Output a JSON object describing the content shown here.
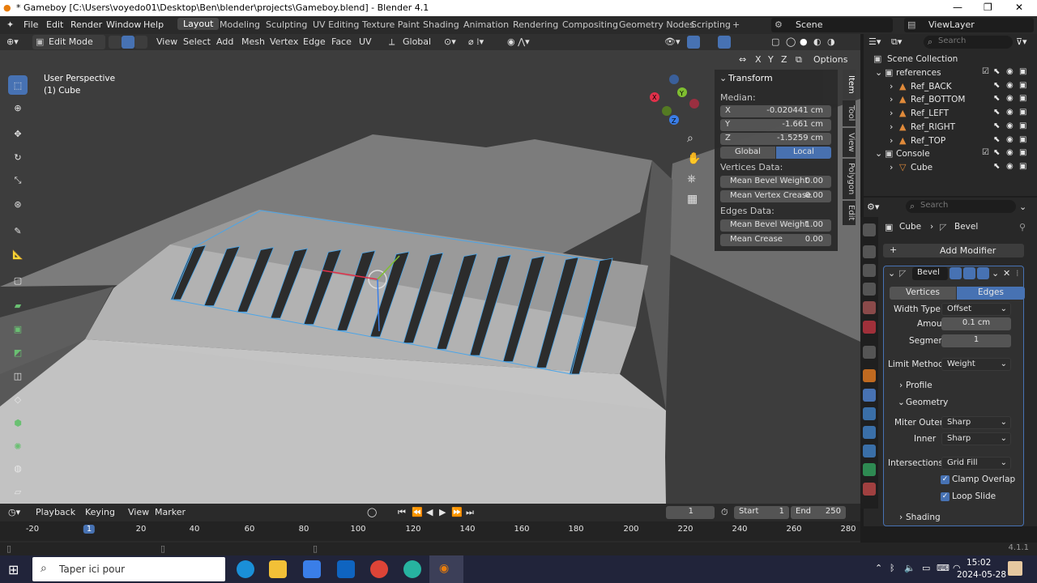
{
  "window": {
    "title": "* Gameboy [C:\\Users\\voyedo01\\Desktop\\Ben\\blender\\projects\\Gameboy.blend] - Blender 4.1",
    "min": "—",
    "max": "❐",
    "close": "✕"
  },
  "menu": {
    "items": [
      "File",
      "Edit",
      "Render",
      "Window",
      "Help"
    ],
    "workspaces": [
      "Layout",
      "Modeling",
      "Sculpting",
      "UV Editing",
      "Texture Paint",
      "Shading",
      "Animation",
      "Rendering",
      "Compositing",
      "Geometry Nodes",
      "Scripting"
    ],
    "add_tab": "+",
    "scene": "Scene",
    "view_layer": "ViewLayer"
  },
  "header3d": {
    "mode": "Edit Mode",
    "menus": [
      "View",
      "Select",
      "Add",
      "Mesh",
      "Vertex",
      "Edge",
      "Face",
      "UV"
    ],
    "orientation": "Global",
    "axes": [
      "X",
      "Y",
      "Z"
    ],
    "options": "Options"
  },
  "viewport": {
    "perspective": "User Perspective",
    "object": "(1) Cube"
  },
  "npanel": {
    "section": "Transform",
    "median_label": "Median:",
    "coords": [
      {
        "axis": "X",
        "value": "-0.020441 cm"
      },
      {
        "axis": "Y",
        "value": "-1.661 cm"
      },
      {
        "axis": "Z",
        "value": "-1.5259 cm"
      }
    ],
    "global": "Global",
    "local": "Local",
    "vertices_data": "Vertices Data:",
    "mean_bevel_weight_v_label": "Mean Bevel Weight",
    "mean_bevel_weight_v": "0.00",
    "mean_vertex_crease_label": "Mean Vertex Crease",
    "mean_vertex_crease": "0.00",
    "edges_data": "Edges Data:",
    "mean_bevel_weight_e_label": "Mean Bevel Weight",
    "mean_bevel_weight_e": "1.00",
    "mean_crease_label": "Mean Crease",
    "mean_crease": "0.00"
  },
  "ntabs": [
    "Item",
    "Tool",
    "View",
    "Polygon",
    "Edit"
  ],
  "outliner": {
    "search_placeholder": "Search",
    "root": "Scene Collection",
    "items": [
      {
        "name": "references",
        "depth": 0
      },
      {
        "name": "Ref_BACK",
        "depth": 1
      },
      {
        "name": "Ref_BOTTOM",
        "depth": 1
      },
      {
        "name": "Ref_LEFT",
        "depth": 1
      },
      {
        "name": "Ref_RIGHT",
        "depth": 1
      },
      {
        "name": "Ref_TOP",
        "depth": 1
      },
      {
        "name": "Console",
        "depth": 0
      },
      {
        "name": "Cube",
        "depth": 1
      }
    ]
  },
  "properties": {
    "search_placeholder": "Search",
    "breadcrumb_object": "Cube",
    "breadcrumb_modifier": "Bevel",
    "add_modifier": "Add Modifier",
    "modifier_name": "Bevel",
    "tab_vertices": "Vertices",
    "tab_edges": "Edges",
    "width_type_label": "Width Type",
    "width_type": "Offset",
    "amount_label": "Amount",
    "amount": "0.1 cm",
    "segments_label": "Segments",
    "segments": "1",
    "limit_method_label": "Limit Method",
    "limit_method": "Weight",
    "profile": "Profile",
    "geometry": "Geometry",
    "miter_outer_label": "Miter Outer",
    "miter_outer": "Sharp",
    "inner_label": "Inner",
    "inner": "Sharp",
    "intersections_label": "Intersections",
    "intersections": "Grid Fill",
    "clamp_overlap": "Clamp Overlap",
    "loop_slide": "Loop Slide",
    "shading": "Shading"
  },
  "timeline": {
    "menus": [
      "Playback",
      "Keying",
      "View",
      "Marker"
    ],
    "current_frame": "1",
    "start_label": "Start",
    "start": "1",
    "end_label": "End",
    "end": "250",
    "ticks": [
      "-20",
      "1",
      "20",
      "40",
      "60",
      "80",
      "100",
      "120",
      "140",
      "160",
      "180",
      "200",
      "220",
      "240",
      "260",
      "280"
    ]
  },
  "status": {
    "version": "4.1.1"
  },
  "taskbar": {
    "search_placeholder": "Taper ici pour",
    "time": "15:02",
    "date": "2024-05-28"
  }
}
